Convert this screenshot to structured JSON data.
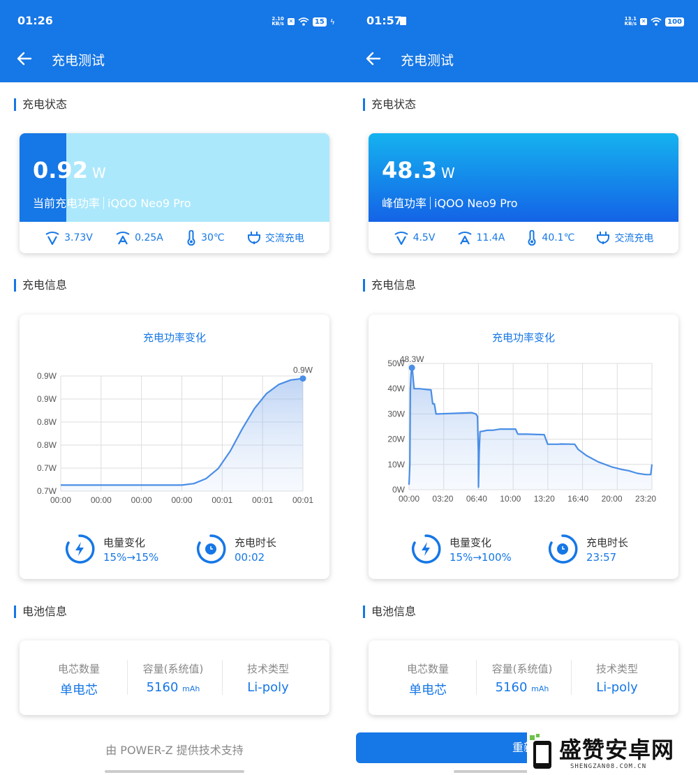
{
  "left": {
    "status": {
      "time": "01:26",
      "netspeed_value": "2.10",
      "netspeed_unit": "KB/s",
      "battery": "15",
      "charging_icon": "bolt-icon"
    },
    "header": {
      "title": "充电测试"
    },
    "sections": {
      "status": "充电状态",
      "info": "充电信息",
      "battery": "电池信息"
    },
    "power": {
      "value": "0.92",
      "unit": "W",
      "label": "当前充电功率",
      "device": "iQOO Neo9 Pro",
      "level_fraction": 0.15
    },
    "metrics": {
      "voltage": "3.73",
      "voltage_unit": "V",
      "current": "0.25",
      "current_unit": "A",
      "temperature": "30",
      "temperature_unit": "℃",
      "charge_type": "交流充电"
    },
    "chart_title": "充电功率变化",
    "stats": {
      "level_label": "电量变化",
      "level_value": "15%→15%",
      "duration_label": "充电时长",
      "duration_value": "00:02"
    },
    "battery_info": {
      "cells_label": "电芯数量",
      "cells_value": "单电芯",
      "capacity_label": "容量(系统值)",
      "capacity_value": "5160",
      "capacity_unit": "mAh",
      "tech_label": "技术类型",
      "tech_value": "Li-poly"
    },
    "footer": "由 POWER-Z 提供技术支持"
  },
  "right": {
    "status": {
      "time": "01:57",
      "netspeed_value": "13.1",
      "netspeed_unit": "KB/s",
      "battery": "100"
    },
    "header": {
      "title": "充电测试"
    },
    "sections": {
      "status": "充电状态",
      "info": "充电信息",
      "battery": "电池信息"
    },
    "power": {
      "value": "48.3",
      "unit": "W",
      "label": "峰值功率",
      "device": "iQOO Neo9 Pro"
    },
    "metrics": {
      "voltage": "4.5",
      "voltage_unit": "V",
      "current": "11.4",
      "current_unit": "A",
      "temperature": "40.1",
      "temperature_unit": "℃",
      "charge_type": "交流充电"
    },
    "chart_title": "充电功率变化",
    "stats": {
      "level_label": "电量变化",
      "level_value": "15%→100%",
      "duration_label": "充电时长",
      "duration_value": "23:57"
    },
    "battery_info": {
      "cells_label": "电芯数量",
      "cells_value": "单电芯",
      "capacity_label": "容量(系统值)",
      "capacity_value": "5160",
      "capacity_unit": "mAh",
      "tech_label": "技术类型",
      "tech_value": "Li-poly"
    },
    "retest_button": "重新"
  },
  "watermark": {
    "title": "盛赞安卓网",
    "subtitle": "SHENGZAN08.COM.CN"
  },
  "colors": {
    "primary": "#1677e6",
    "light_fill": "#ace8fb",
    "text": "#333333",
    "muted": "#888888"
  },
  "chart_data": [
    {
      "type": "area",
      "title": "充电功率变化",
      "xlabel": "",
      "ylabel": "",
      "x_ticks": [
        "00:00",
        "00:00",
        "00:00",
        "00:00",
        "00:01",
        "00:01",
        "00:01"
      ],
      "y_ticks": [
        "0.7W",
        "0.7W",
        "0.8W",
        "0.8W",
        "0.9W",
        "0.9W"
      ],
      "ylim": [
        0.7,
        0.93
      ],
      "grid": true,
      "peak_label": "0.9W",
      "series": [
        {
          "x": [
            0,
            0.1,
            0.2,
            0.3,
            0.4,
            0.5,
            0.55,
            0.6,
            0.65,
            0.7,
            0.75,
            0.8,
            0.85,
            0.9,
            0.95,
            1.0
          ],
          "y": [
            0.712,
            0.712,
            0.712,
            0.712,
            0.712,
            0.712,
            0.715,
            0.725,
            0.745,
            0.78,
            0.825,
            0.865,
            0.895,
            0.913,
            0.922,
            0.925
          ]
        }
      ]
    },
    {
      "type": "area",
      "title": "充电功率变化",
      "xlabel": "",
      "ylabel": "",
      "x_ticks": [
        "00:00",
        "03:20",
        "06:40",
        "10:00",
        "13:20",
        "16:40",
        "20:00",
        "23:20"
      ],
      "x_ticks_min": [
        0,
        200,
        400,
        600,
        800,
        1000,
        1200,
        1400
      ],
      "y_ticks": [
        "0W",
        "10W",
        "20W",
        "30W",
        "40W",
        "50W"
      ],
      "ylim": [
        0,
        50
      ],
      "xlim_min": [
        0,
        1437
      ],
      "grid": true,
      "peak_label": "48.3W",
      "series": [
        {
          "x_min": [
            0,
            5,
            8,
            12,
            17,
            20,
            30,
            60,
            130,
            140,
            150,
            160,
            170,
            370,
            395,
            405,
            410,
            411,
            415,
            420,
            440,
            460,
            500,
            540,
            560,
            580,
            630,
            640,
            645,
            700,
            800,
            820,
            880,
            900,
            980,
            1000,
            1050,
            1120,
            1200,
            1260,
            1300,
            1350,
            1400,
            1430,
            1437
          ],
          "y": [
            2,
            10,
            40,
            46,
            48.3,
            47.5,
            40,
            40,
            39.5,
            34,
            34,
            30,
            30,
            30.5,
            30,
            29,
            15,
            1,
            15,
            23,
            23.2,
            23.5,
            23.6,
            24,
            24,
            24,
            24,
            22.5,
            22,
            22,
            21.8,
            18,
            18,
            18.1,
            18,
            16,
            13.5,
            11,
            9,
            8,
            7.5,
            6.5,
            6,
            6,
            10
          ]
        }
      ]
    }
  ]
}
